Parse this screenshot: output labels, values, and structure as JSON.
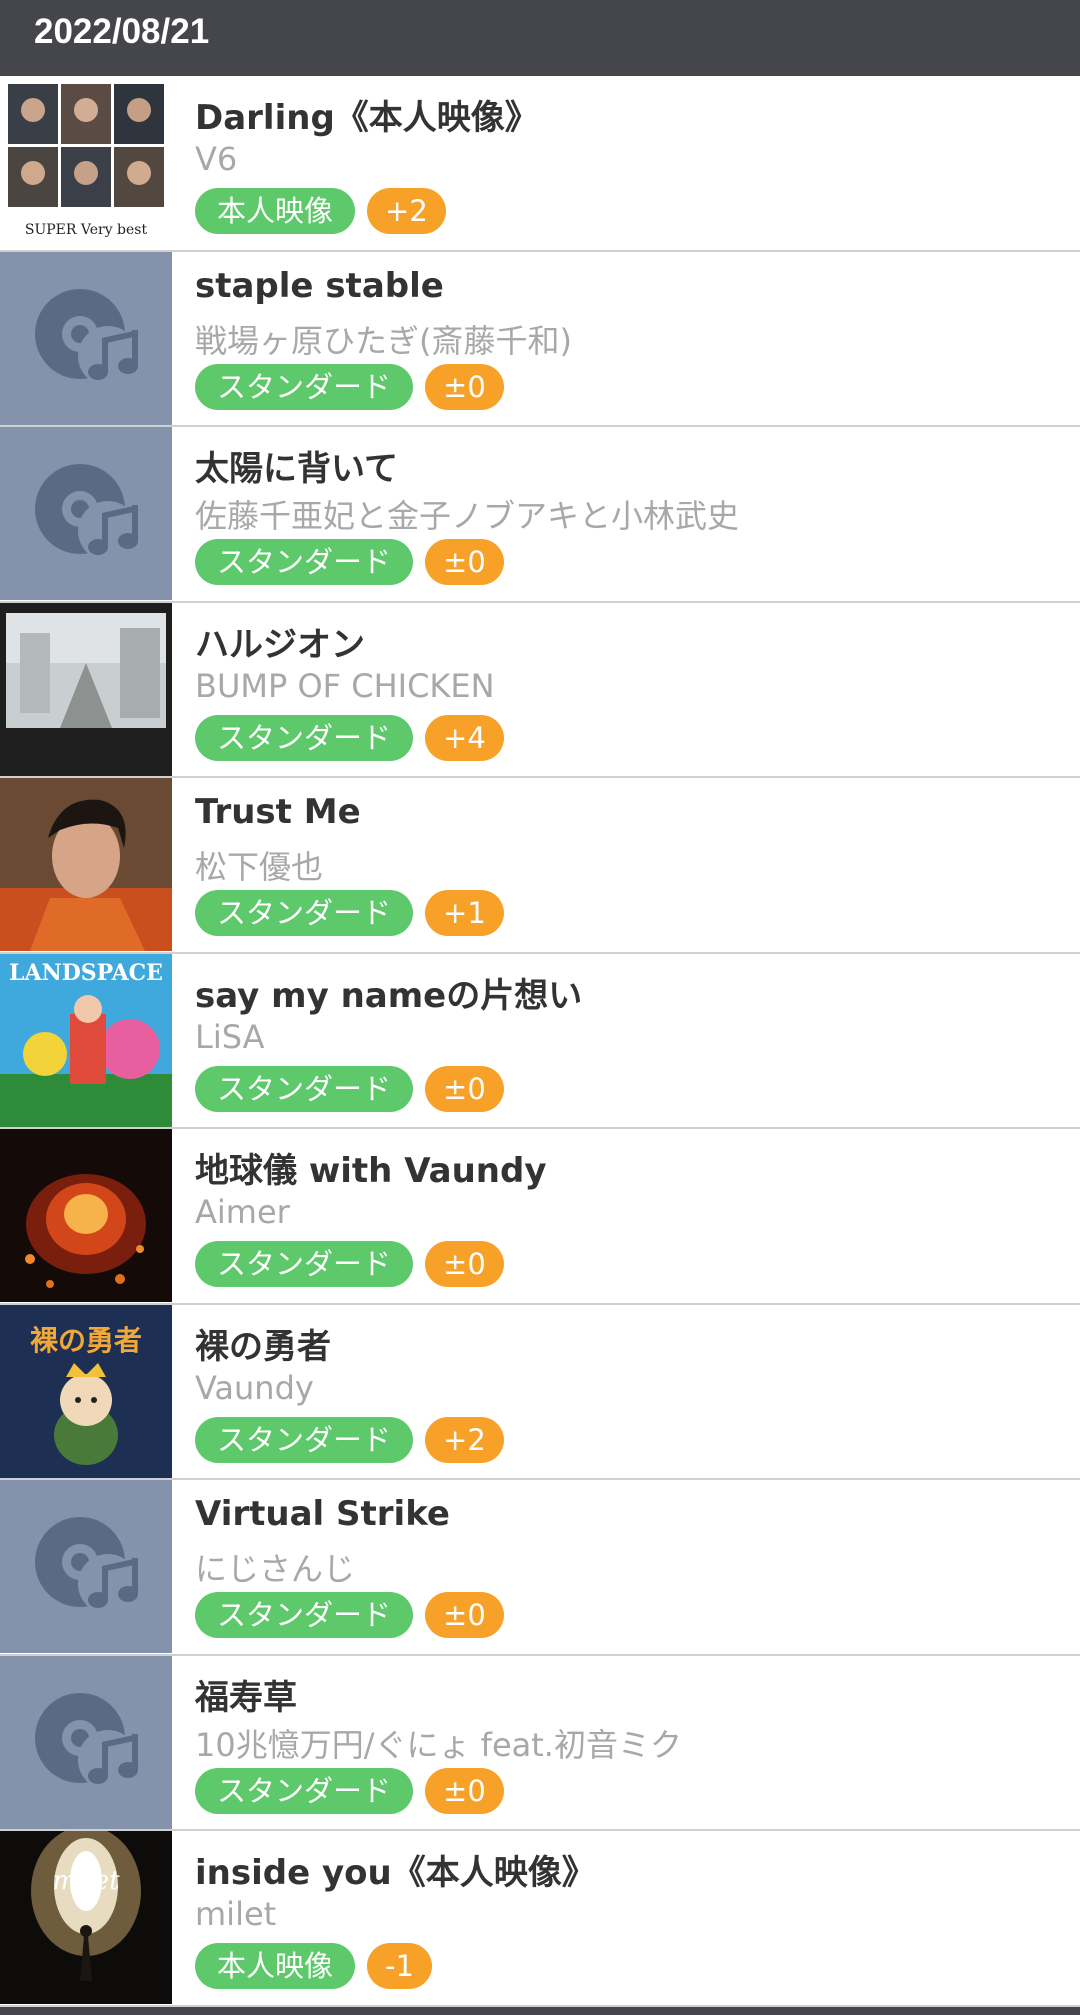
{
  "header": {
    "date": "2022/08/21"
  },
  "colors": {
    "header_bg": "#44464b",
    "tag_type": "#5dc96b",
    "tag_key": "#f7a128",
    "placeholder_bg": "#8492ac",
    "placeholder_icon": "#5c6985"
  },
  "songs": [
    {
      "title": "Darling《本人映像》",
      "artist": "V6",
      "type": "本人映像",
      "key": "+2",
      "art": "group-photo-grid",
      "cover_text": "SUPER Very best"
    },
    {
      "title": "staple stable",
      "artist": "戦場ヶ原ひたぎ(斎藤千和)",
      "type": "スタンダード",
      "key": "±0",
      "art": "placeholder"
    },
    {
      "title": "太陽に背いて",
      "artist": "佐藤千亜妃と金子ノブアキと小林武史",
      "type": "スタンダード",
      "key": "±0",
      "art": "placeholder"
    },
    {
      "title": "ハルジオン",
      "artist": "BUMP OF CHICKEN",
      "type": "スタンダード",
      "key": "+4",
      "art": "street-photo"
    },
    {
      "title": "Trust Me",
      "artist": "松下優也",
      "type": "スタンダード",
      "key": "+1",
      "art": "portrait"
    },
    {
      "title": "say my nameの片想い",
      "artist": "LiSA",
      "type": "スタンダード",
      "key": "±0",
      "art": "landspace-cover",
      "cover_text": "LANDSPACE"
    },
    {
      "title": "地球儀 with Vaundy",
      "artist": "Aimer",
      "type": "スタンダード",
      "key": "±0",
      "art": "fire-cover"
    },
    {
      "title": "裸の勇者",
      "artist": "Vaundy",
      "type": "スタンダード",
      "key": "+2",
      "art": "anime-cover",
      "cover_text": "裸の勇者"
    },
    {
      "title": "Virtual Strike",
      "artist": "にじさんじ",
      "type": "スタンダード",
      "key": "±0",
      "art": "placeholder"
    },
    {
      "title": "福寿草",
      "artist": "10兆憶万円/ぐにょ feat.初音ミク",
      "type": "スタンダード",
      "key": "±0",
      "art": "placeholder"
    },
    {
      "title": "inside you《本人映像》",
      "artist": "milet",
      "type": "本人映像",
      "key": "-1",
      "art": "light-cover",
      "cover_text": "milet"
    }
  ]
}
